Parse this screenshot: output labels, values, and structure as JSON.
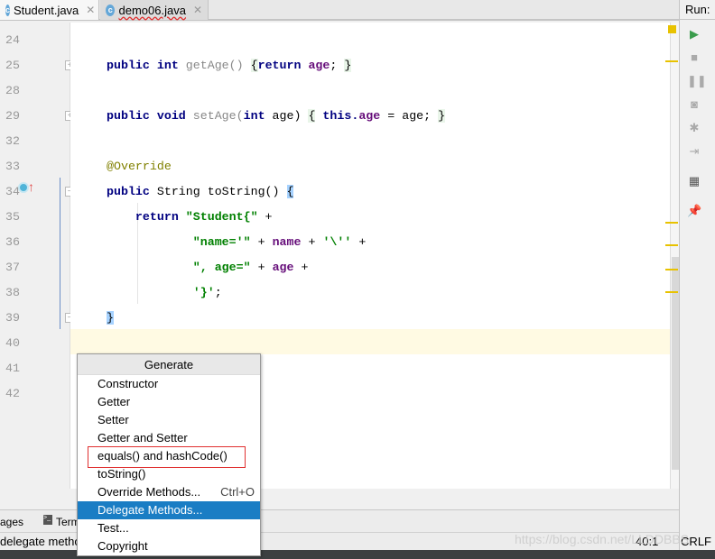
{
  "tabs": [
    {
      "label": "Student.java",
      "icon": "class-icon"
    },
    {
      "label": "demo06.java",
      "icon": "runnable-class-icon"
    }
  ],
  "code": [
    {
      "n": "24",
      "parts": []
    },
    {
      "n": "25",
      "parts": [
        [
          "kw",
          "public int "
        ],
        [
          "gr",
          "getAge() "
        ],
        [
          "gbg",
          "{"
        ],
        [
          "kw",
          "return "
        ],
        [
          "fld",
          "age"
        ],
        [
          "",
          "; "
        ],
        [
          "gbg",
          "}"
        ]
      ],
      "fold": "+"
    },
    {
      "n": "28",
      "parts": []
    },
    {
      "n": "29",
      "parts": [
        [
          "kw",
          "public void "
        ],
        [
          "gr",
          "setAge("
        ],
        [
          "kw",
          "int "
        ],
        [
          "",
          "age) "
        ],
        [
          "gbg",
          "{"
        ],
        [
          "kw",
          " this."
        ],
        [
          "fld",
          "age"
        ],
        [
          "",
          " = age; "
        ],
        [
          "gbg",
          "}"
        ]
      ],
      "fold": "+"
    },
    {
      "n": "32",
      "parts": []
    },
    {
      "n": "33",
      "parts": [
        [
          "ann",
          "@Override"
        ]
      ]
    },
    {
      "n": "34",
      "parts": [
        [
          "kw",
          "public "
        ],
        [
          "",
          "String toString() "
        ],
        [
          "bbg",
          "{"
        ]
      ],
      "fold": "-"
    },
    {
      "n": "35",
      "parts": [
        [
          "",
          "    "
        ],
        [
          "kw",
          "return "
        ],
        [
          "str",
          "\"Student{\""
        ],
        [
          "",
          " +"
        ]
      ]
    },
    {
      "n": "36",
      "parts": [
        [
          "",
          "            "
        ],
        [
          "str",
          "\"name='\""
        ],
        [
          "",
          " + "
        ],
        [
          "fld",
          "name"
        ],
        [
          "",
          " + "
        ],
        [
          "str",
          "'\\''"
        ],
        [
          "",
          " +"
        ]
      ]
    },
    {
      "n": "37",
      "parts": [
        [
          "",
          "            "
        ],
        [
          "str",
          "\", age=\""
        ],
        [
          "",
          " + "
        ],
        [
          "fld",
          "age"
        ],
        [
          "",
          " +"
        ]
      ]
    },
    {
      "n": "38",
      "parts": [
        [
          "",
          "            "
        ],
        [
          "str",
          "'}'"
        ],
        [
          "",
          ";"
        ]
      ]
    },
    {
      "n": "39",
      "parts": [
        [
          "bbg",
          "}"
        ]
      ],
      "fold": "-"
    },
    {
      "n": "40",
      "parts": []
    },
    {
      "n": "41",
      "parts": []
    },
    {
      "n": "42",
      "parts": []
    }
  ],
  "right_panel": {
    "title": "Run:",
    "icons": [
      "run-icon",
      "stop-icon",
      "pause-icon",
      "camera-icon",
      "debug-icon",
      "exit-icon",
      "layout-icon",
      "pin-icon"
    ]
  },
  "tool_windows": {
    "messages": "ages",
    "terminal": "Term"
  },
  "status": {
    "message": "delegate metho",
    "position": "40:1",
    "line_separator": "CRLF"
  },
  "popup": {
    "title": "Generate",
    "items": [
      {
        "label": "Constructor"
      },
      {
        "label": "Getter"
      },
      {
        "label": "Setter"
      },
      {
        "label": "Getter and Setter"
      },
      {
        "label": "equals() and hashCode()"
      },
      {
        "label": "toString()"
      },
      {
        "label": "Override Methods...",
        "shortcut": "Ctrl+O"
      },
      {
        "label": "Delegate Methods...",
        "selected": true
      },
      {
        "label": "Test..."
      },
      {
        "label": "Copyright"
      }
    ]
  },
  "watermark": "https://blog.csdn.net/LLDDBBS",
  "colors": {
    "keyword": "#000080",
    "field": "#660e7a",
    "string": "#008000",
    "selection": "#1a7dc4",
    "highlight_box": "#e03030"
  }
}
